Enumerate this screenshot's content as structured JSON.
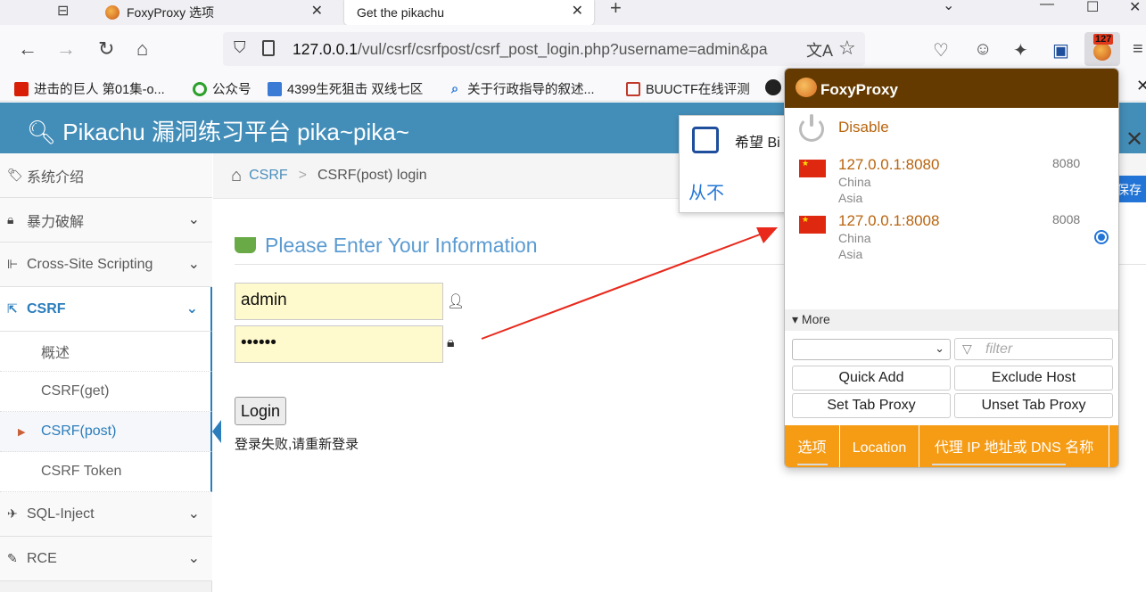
{
  "browser": {
    "tabs": [
      {
        "title": "FoxyProxy 选项"
      },
      {
        "title": "Get the pikachu"
      }
    ],
    "new_tab": "+",
    "url_host": "127.0.0.1",
    "url_rest": "/vul/csrf/csrfpost/csrf_post_login.php?username=admin&pa",
    "foxy_badge": "127",
    "bookmarks": [
      {
        "label": "进击的巨人 第01集-o..."
      },
      {
        "label": "公众号"
      },
      {
        "label": "4399生死狙击 双线七区"
      },
      {
        "label": "关于行政指导的叙述..."
      },
      {
        "label": "BUUCTF在线评测"
      }
    ]
  },
  "header": {
    "title": "Pikachu 漏洞练习平台 pika~pika~"
  },
  "sidebar": {
    "items": [
      {
        "label": "系统介绍"
      },
      {
        "label": "暴力破解"
      },
      {
        "label": "Cross-Site Scripting"
      },
      {
        "label": "CSRF"
      },
      {
        "label": "SQL-Inject"
      },
      {
        "label": "RCE"
      }
    ],
    "csrf_sub": [
      {
        "label": "概述"
      },
      {
        "label": "CSRF(get)"
      },
      {
        "label": "CSRF(post)"
      },
      {
        "label": "CSRF Token"
      }
    ]
  },
  "breadcrumb": {
    "link": "CSRF",
    "sep": ">",
    "current": "CSRF(post) login"
  },
  "form": {
    "title": "Please Enter Your Information",
    "username": "admin",
    "password": "••••••",
    "login_label": "Login",
    "message": "登录失败,请重新登录"
  },
  "notification": {
    "text": "希望 Bi",
    "deny": "从不",
    "save": "保存"
  },
  "foxy": {
    "title": "FoxyProxy",
    "disable": "Disable",
    "proxies": [
      {
        "host": "127.0.0.1:8080",
        "port": "8080",
        "country": "China",
        "region": "Asia",
        "selected": false
      },
      {
        "host": "127.0.0.1:8008",
        "port": "8008",
        "country": "China",
        "region": "Asia",
        "selected": true
      }
    ],
    "more": "▾ More",
    "filter_placeholder": "filter",
    "buttons": {
      "quick_add": "Quick Add",
      "exclude_host": "Exclude Host",
      "set_tab": "Set Tab Proxy",
      "unset_tab": "Unset Tab Proxy"
    },
    "footer_tabs": [
      {
        "label": "选项"
      },
      {
        "label": "Location"
      },
      {
        "label": "代理 IP 地址或 DNS 名称"
      }
    ]
  },
  "colors": {
    "header_blue": "#438eb9",
    "foxy_brown": "#653a00",
    "foxy_orange": "#f59b14",
    "accent": "#2b7dbc"
  }
}
